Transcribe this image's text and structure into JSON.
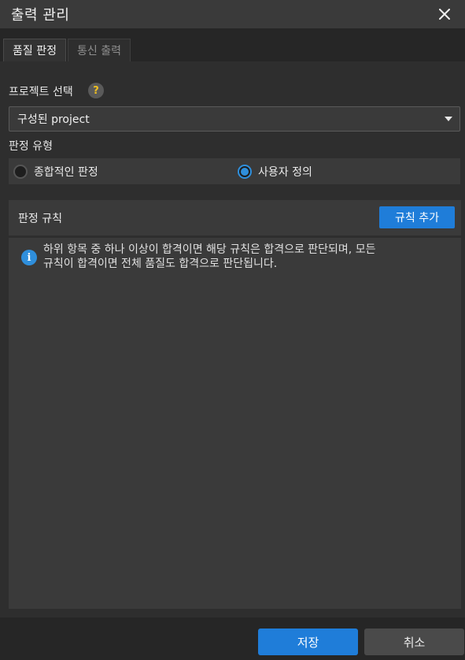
{
  "window": {
    "title": "출력 관리"
  },
  "tabs": [
    {
      "label": "품질 판정",
      "active": true
    },
    {
      "label": "통신 출력",
      "active": false
    }
  ],
  "project": {
    "label": "프로젝트 선택",
    "help_icon": "?",
    "selected": "구성된 project"
  },
  "judgment_type": {
    "label": "판정 유형",
    "options": [
      {
        "label": "종합적인 판정",
        "checked": false
      },
      {
        "label": "사용자 정의",
        "checked": true
      }
    ]
  },
  "rules": {
    "title": "판정 규칙",
    "add_button": "규칙 추가",
    "info_line1": "하위 항목 중 하나 이상이 합격이면 해당 규칙은 합격으로 판단되며, 모든",
    "info_line2": "규칙이 합격이면 전체 품질도 합격으로 판단됩니다."
  },
  "footer": {
    "save": "저장",
    "cancel": "취소"
  },
  "colors": {
    "accent": "#1f7dd9",
    "background": "#2b2b2b",
    "panel": "#3a3a3a"
  }
}
